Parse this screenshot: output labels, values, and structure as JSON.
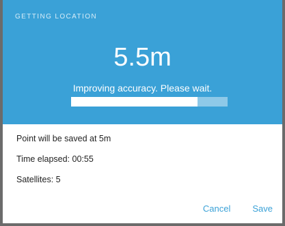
{
  "dialog": {
    "title": "GETTING LOCATION",
    "accuracy": "5.5m",
    "hint": "Improving accuracy. Please wait.",
    "progress_fraction": 0.81,
    "lines": [
      "Point will be saved at 5m",
      "Time elapsed: 00:55",
      "Satellites: 5"
    ],
    "cancel_label": "Cancel",
    "save_label": "Save"
  },
  "colors": {
    "header": "#3aa1d7",
    "accent": "#3aa1d7"
  }
}
